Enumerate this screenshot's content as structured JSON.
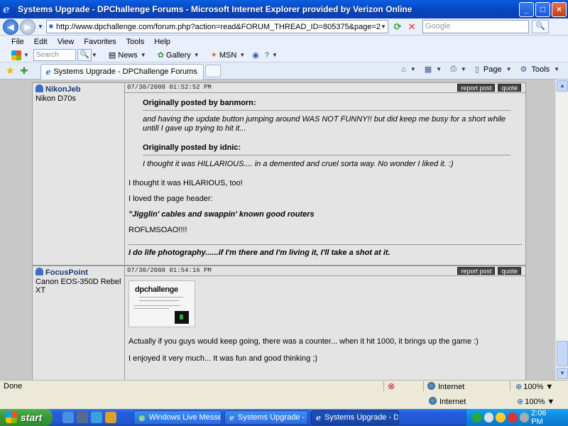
{
  "window": {
    "title": "Systems Upgrade - DPChallenge Forums - Microsoft Internet Explorer provided by Verizon Online",
    "buttons": [
      "_",
      "□",
      "×"
    ]
  },
  "address_bar": {
    "url": "http://www.dpchallenge.com/forum.php?action=read&FORUM_THREAD_ID=805375&page=2",
    "search_placeholder": "Google"
  },
  "menu": [
    "File",
    "Edit",
    "View",
    "Favorites",
    "Tools",
    "Help"
  ],
  "live_toolbar": {
    "search_placeholder": "Search web...",
    "items": [
      "News",
      "Gallery",
      "MSN"
    ]
  },
  "tab": {
    "label": "Systems Upgrade - DPChallenge Forums"
  },
  "command_bar": {
    "page": "Page",
    "tools": "Tools"
  },
  "posts": [
    {
      "username": "NikonJeb",
      "camera": "Nikon D70s",
      "timestamp": "07/30/2008 01:52:52 PM",
      "report_label": "report post",
      "quote_label": "quote",
      "quotes": [
        {
          "head": "Originally posted by banmorn:",
          "text": "and having the update button jumping around WAS NOT FUNNY!! but did keep me busy for a short while untill I gave up trying to hit it..."
        },
        {
          "head": "Originally posted by idnic:",
          "text": "I thought it was HILLARIOUS.... in a demented and cruel sorta way. No wonder I liked it. :)"
        }
      ],
      "paragraphs": [
        "I thought it was HILARIOUS, too!",
        "I loved the page header:",
        "\"Jigglin' cables and swappin' known good routers",
        "ROFLMSOAO!!!!"
      ],
      "signature": "I do life photography......if I'm there and I'm living it, I'll take a shot at it."
    },
    {
      "username": "FocusPoint",
      "camera": "Canon EOS-350D Rebel XT",
      "timestamp": "07/30/2008 01:54:16 PM",
      "report_label": "report post",
      "quote_label": "quote",
      "image_logo": "dpchallenge",
      "paragraphs": [
        "Actually if you guys would keep going, there was a counter... when it hit 1000, it brings up the game :)",
        "I enjoyed it very much... It was fun and good thinking ;)"
      ]
    }
  ],
  "status": {
    "text": "Done",
    "zone": "Internet",
    "zoom": "100%"
  },
  "taskbar": {
    "start": "start",
    "tasks": [
      "Windows Live Messen...",
      "Systems Upgrade - D...",
      "Systems Upgrade - D..."
    ],
    "clock": "2:06 PM"
  }
}
